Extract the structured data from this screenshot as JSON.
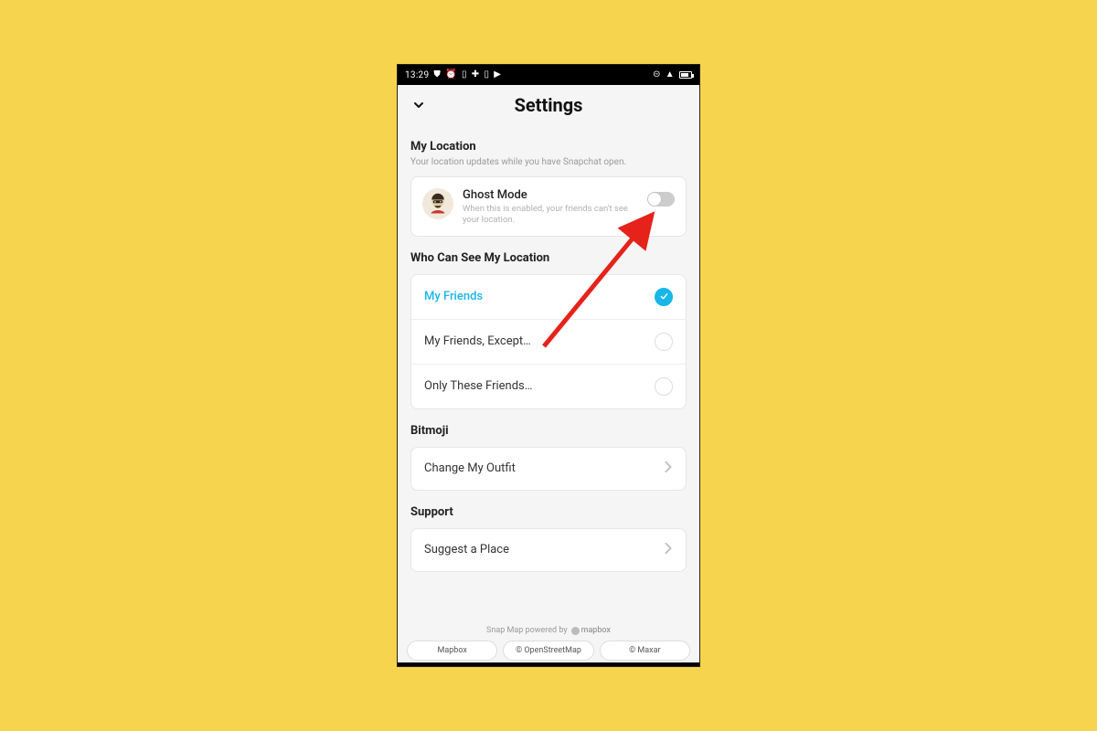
{
  "statusbar": {
    "time": "13:29"
  },
  "header": {
    "title": "Settings"
  },
  "location": {
    "section_title": "My Location",
    "section_sub": "Your location updates while you have Snapchat open.",
    "ghost": {
      "title": "Ghost Mode",
      "desc": "When this is enabled, your friends can't see your location.",
      "enabled": false
    }
  },
  "visibility": {
    "section_title": "Who Can See My Location",
    "options": [
      {
        "label": "My Friends",
        "selected": true
      },
      {
        "label": "My Friends, Except…",
        "selected": false
      },
      {
        "label": "Only These Friends…",
        "selected": false
      }
    ]
  },
  "bitmoji": {
    "section_title": "Bitmoji",
    "row_label": "Change My Outfit"
  },
  "support": {
    "section_title": "Support",
    "row_label": "Suggest a Place"
  },
  "footer": {
    "powered_text": "Snap Map powered by",
    "mapbox_label": "mapbox",
    "credits": [
      "Mapbox",
      "© OpenStreetMap",
      "© Maxar"
    ]
  }
}
